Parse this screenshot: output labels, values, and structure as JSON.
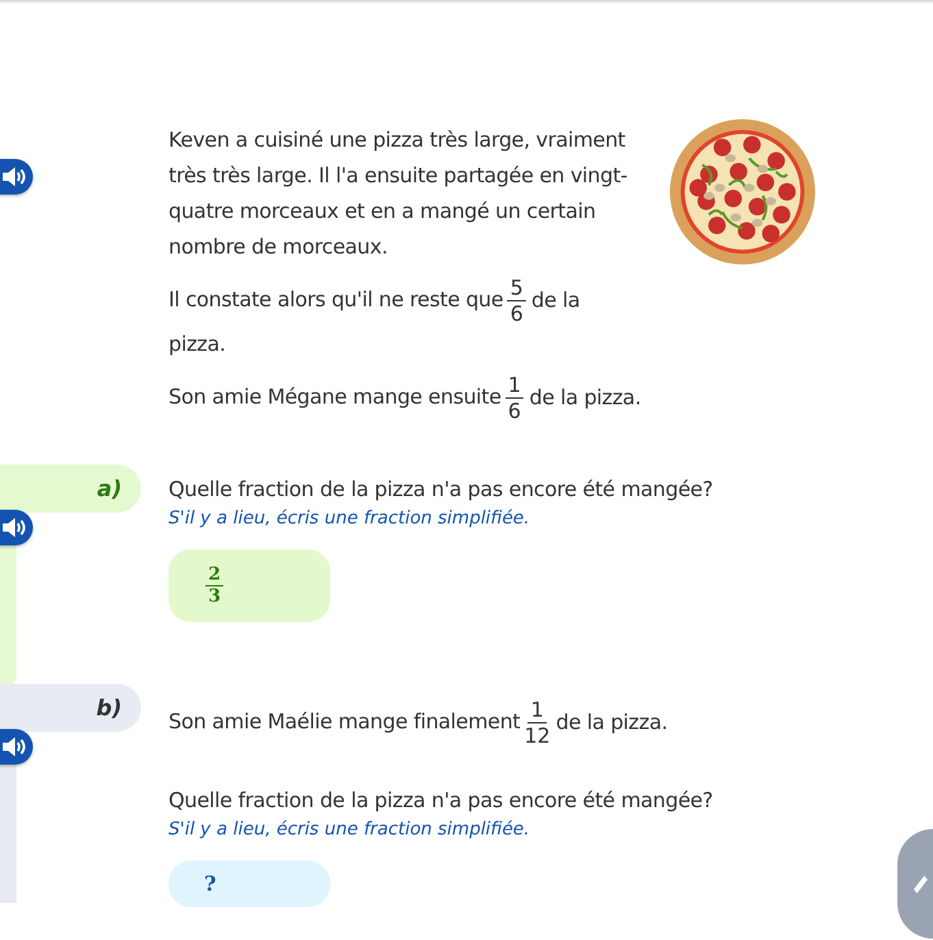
{
  "intro": {
    "paragraphs": [
      [
        {
          "kind": "text",
          "text": "Keven a cuisiné une pizza très large, vraiment très très large. Il l'a ensuite partagée en vingt-quatre morceaux et en a mangé un certain nombre de morceaux."
        }
      ],
      [
        {
          "kind": "text",
          "text": "Il constate alors qu'il ne reste que"
        },
        {
          "kind": "fraction",
          "numerator": "5",
          "denominator": "6"
        },
        {
          "kind": "text",
          "text": "de la"
        },
        {
          "kind": "text",
          "text": "pizza."
        }
      ],
      [
        {
          "kind": "text",
          "text": "Son amie Mégane mange ensuite"
        },
        {
          "kind": "fraction",
          "numerator": "1",
          "denominator": "6"
        },
        {
          "kind": "text",
          "text": "de la pizza."
        }
      ]
    ]
  },
  "questions": [
    {
      "label": "a)",
      "answered": true,
      "question": "Quelle fraction de la pizza n'a pas encore été mangée?",
      "hint": "S'il y a lieu, écris une fraction simplifiée.",
      "answer": {
        "kind": "fraction",
        "numerator": "2",
        "denominator": "3"
      }
    },
    {
      "label": "b)",
      "answered": false,
      "context": [
        {
          "kind": "text",
          "text": "Son amie Maélie mange finalement"
        },
        {
          "kind": "fraction",
          "numerator": "1",
          "denominator": "12"
        },
        {
          "kind": "text",
          "text": "de la pizza."
        }
      ],
      "question": "Quelle fraction de la pizza n'a pas encore été mangée?",
      "hint": "S'il y a lieu, écris une fraction simplifiée.",
      "answer": {
        "kind": "empty",
        "placeholder": "?"
      }
    }
  ]
}
